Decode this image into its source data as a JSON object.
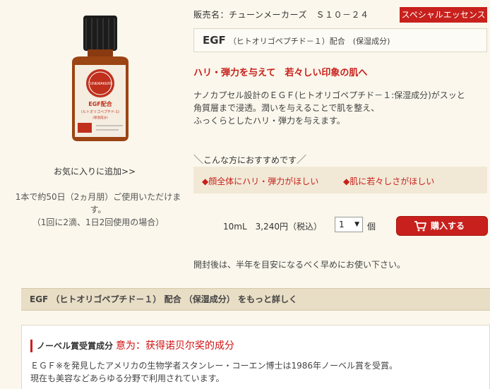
{
  "product": {
    "bottle_label_brand": "TUNEMAKERS",
    "bottle_label_name": "EGF配合",
    "bottle_label_sub": "(ヒトオリゴペプチド-1)",
    "bottle_label_tag": "(保湿成分)",
    "favorite_link": "お気に入りに追加>>",
    "usage_line1": "1本で約50日（2ヵ月朋）ご使用いただけます。",
    "usage_line2": "（1回に2滴、1日2回使用の場合）"
  },
  "header": {
    "seller": "販売名：チューンメーカーズ　Ｓ１０－２４",
    "category": "スペシャルエッセンス"
  },
  "title": {
    "main": "EGF",
    "sub": "（ヒトオリゴペプチド－１）配合　(保湿成分)"
  },
  "catchcopy": "ハリ・弾力を与えて　若々しい印象の肌へ",
  "description": [
    "ナノカプセル設計のＥＧＦ(ヒトオリゴペプチド－１:保湿成分)がスッと",
    "角質層まで浸透。潤いを与えることで肌を整え、",
    "ふっくらとしたハリ・弾力を与えます。"
  ],
  "recommend": {
    "heading_prefix": "＼",
    "heading": "こんな方におすすめです",
    "heading_suffix": "／",
    "items": [
      "◆顔全体にハリ・弾力がほしい",
      "◆肌に若々しさがほしい"
    ]
  },
  "purchase": {
    "price": "10mL　3,240円（税込）",
    "quantity": "1",
    "unit": "個",
    "buy_label": "購入する"
  },
  "notice": "開封後は、半年を目安になるべく早めにお使い下さい。",
  "details": {
    "more_title": "EGF （ヒトオリゴペプチド－１） 配合 （保湿成分） をもっと詳しく",
    "nobel_title": "ノーベル賞受賞成分",
    "nobel_note": "意为：获得诺贝尔奖的成分",
    "nobel_line1": "ＥＧＦ※を発見したアメリカの生物学者スタンレー・コーエン博士は1986年ノーベル賞を受賞。",
    "nobel_line2": "現在も美容などあらゆる分野で利用されています。"
  },
  "colors": {
    "accent": "#c8201c",
    "background": "#fbf7ec",
    "recommend_bg": "#f1e9d6"
  }
}
